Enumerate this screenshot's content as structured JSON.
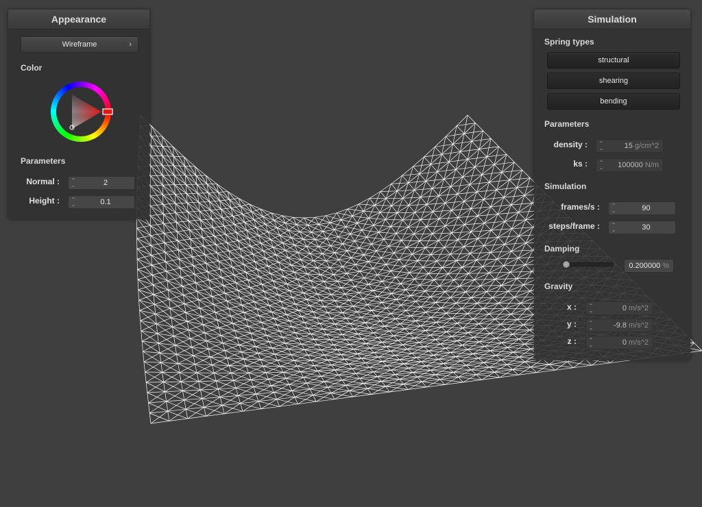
{
  "appearance": {
    "title": "Appearance",
    "mode_label": "Wireframe",
    "mode_arrow": "›",
    "color_label": "Color",
    "selected_color": "#e01818",
    "params_label": "Parameters",
    "normal_label": "Normal :",
    "normal_value": "2",
    "height_label": "Height :",
    "height_value": "0.1"
  },
  "simulation": {
    "title": "Simulation",
    "spring_types_label": "Spring types",
    "spring_types": [
      "structural",
      "shearing",
      "bending"
    ],
    "params_label": "Parameters",
    "density_label": "density :",
    "density_value": "15",
    "density_unit": "g/cm^2",
    "ks_label": "ks :",
    "ks_value": "100000",
    "ks_unit": "N/m",
    "sim_label": "Simulation",
    "fps_label": "frames/s :",
    "fps_value": "90",
    "steps_label": "steps/frame :",
    "steps_value": "30",
    "damping_label": "Damping",
    "damping_value": "0.200000",
    "damping_unit": "%",
    "gravity_label": "Gravity",
    "gx_label": "x :",
    "gx_value": "0",
    "gy_label": "y :",
    "gy_value": "-9.8",
    "gz_label": "z :",
    "gz_value": "0",
    "g_unit": "m/s^2"
  },
  "colors": {
    "background": "#3f3f3f",
    "mesh": "#ffffff"
  }
}
